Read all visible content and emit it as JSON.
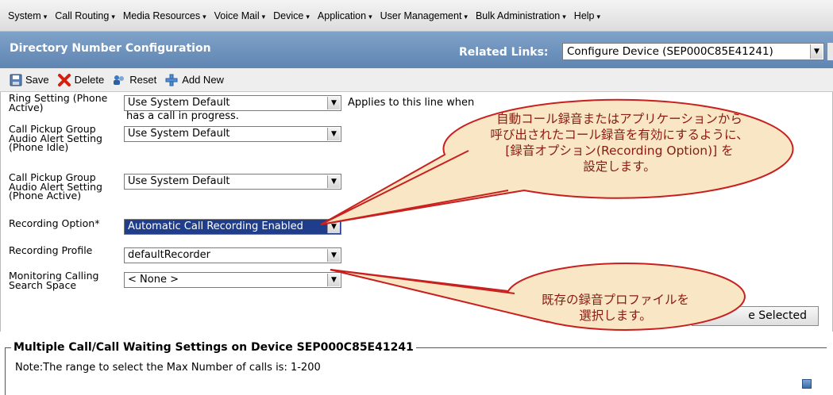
{
  "menu": {
    "items": [
      {
        "label": "System"
      },
      {
        "label": "Call Routing"
      },
      {
        "label": "Media Resources"
      },
      {
        "label": "Voice Mail"
      },
      {
        "label": "Device"
      },
      {
        "label": "Application"
      },
      {
        "label": "User Management"
      },
      {
        "label": "Bulk Administration"
      },
      {
        "label": "Help"
      }
    ]
  },
  "header": {
    "title": "Directory Number Configuration",
    "related_links_label": "Related Links:",
    "related_links_value": "Configure Device (SEP000C85E41241)"
  },
  "toolbar": {
    "save_label": "Save",
    "delete_label": "Delete",
    "reset_label": "Reset",
    "add_new_label": "Add New"
  },
  "form": {
    "ring_setting_label": "Ring Setting (Phone Active)",
    "ring_setting_value": "Use System Default",
    "ring_setting_note": "Applies to this line when",
    "ring_setting_note2": "has a call in progress.",
    "pickup_idle_label": "Call Pickup Group Audio Alert Setting (Phone Idle)",
    "pickup_idle_value": "Use System Default",
    "pickup_active_label": "Call Pickup Group Audio Alert Setting (Phone Active)",
    "pickup_active_value": "Use System Default",
    "recording_option_label": "Recording Option*",
    "recording_option_value": "Automatic Call Recording Enabled",
    "recording_profile_label": "Recording Profile",
    "recording_profile_value": "defaultRecorder",
    "monitoring_css_label": "Monitoring Calling Search Space",
    "monitoring_css_value": "< None >",
    "selected_button_label": "e Selected"
  },
  "section": {
    "title": "Multiple Call/Call Waiting Settings on Device SEP000C85E41241",
    "note": "Note:The range to select the Max Number of calls is: 1-200"
  },
  "callouts": {
    "top": [
      "自動コール録音またはアプリケーションから",
      "呼び出されたコール録音を有効にするように、",
      "[録音オプション(Recording Option)] を",
      "設定します。"
    ],
    "bottom": [
      "既存の録音プロファイルを",
      "選択します。"
    ]
  },
  "colors": {
    "title_bar": "#6b8fba",
    "selected_field": "#1f3d8a",
    "callout_fill": "#f9e6c4",
    "callout_stroke": "#c8201e"
  }
}
